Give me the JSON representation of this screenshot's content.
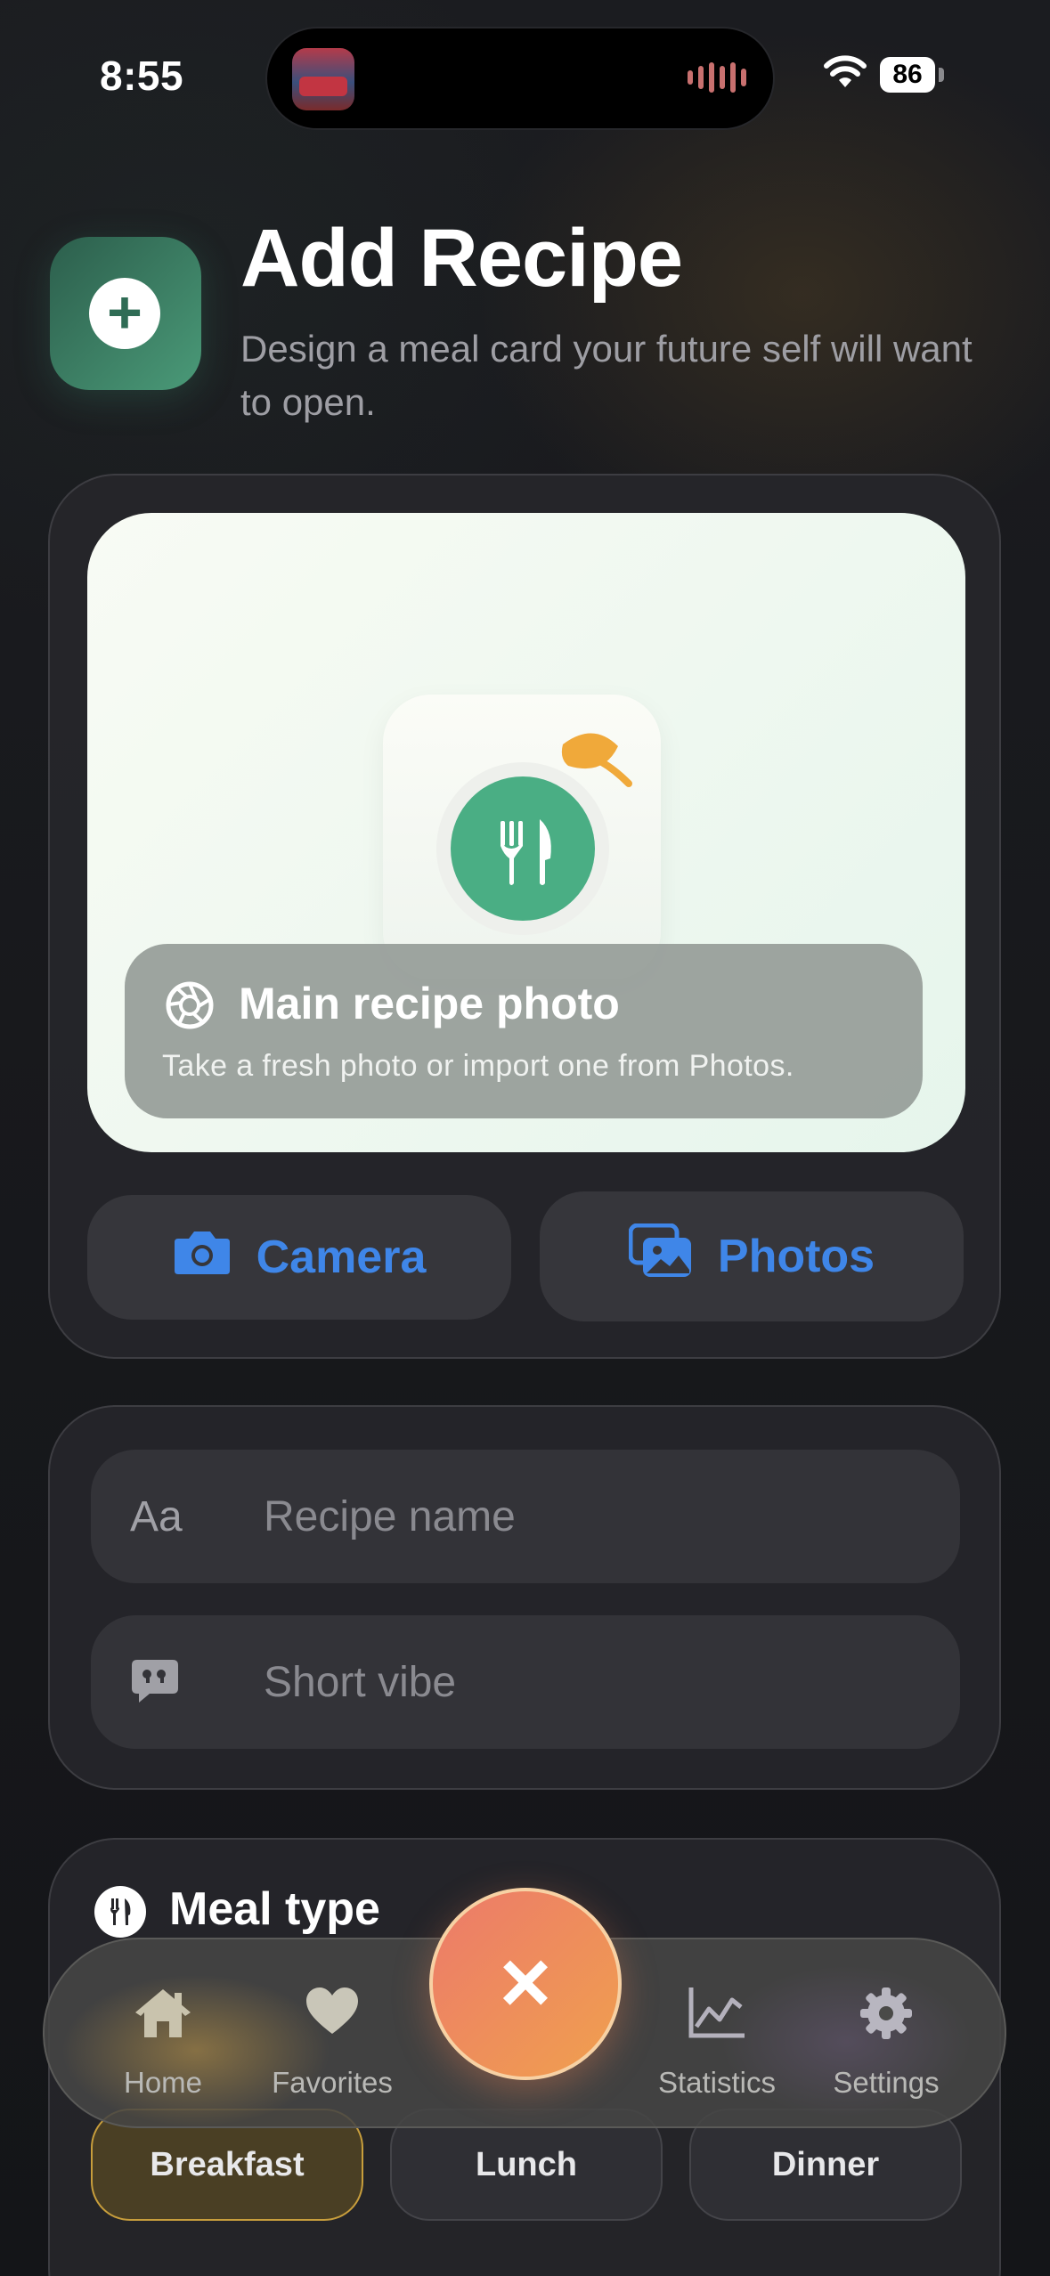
{
  "status_bar": {
    "time": "8:55",
    "battery": "86"
  },
  "header": {
    "title": "Add Recipe",
    "subtitle": "Design a meal card your future self will want to open."
  },
  "photo_card": {
    "caption_title": "Main recipe photo",
    "caption_subtitle": "Take a fresh photo or import one from Photos.",
    "camera_label": "Camera",
    "photos_label": "Photos"
  },
  "form": {
    "name_prefix": "Aa",
    "name_placeholder": "Recipe name",
    "vibe_placeholder": "Short vibe"
  },
  "meal_type": {
    "title": "Meal type",
    "options": [
      "Breakfast",
      "Lunch",
      "Dinner"
    ],
    "selected": "Breakfast"
  },
  "tab_bar": {
    "items": [
      {
        "label": "Home",
        "icon": "house-icon"
      },
      {
        "label": "Favorites",
        "icon": "heart-icon"
      },
      {
        "label": "Statistics",
        "icon": "chart-icon"
      },
      {
        "label": "Settings",
        "icon": "gear-icon"
      }
    ],
    "center_action": "×"
  },
  "colors": {
    "accent_blue": "#3f86e8",
    "brand_green": "#4aae84",
    "fab_orange": "#f0a04e",
    "selected_gold": "#c89e3c"
  }
}
